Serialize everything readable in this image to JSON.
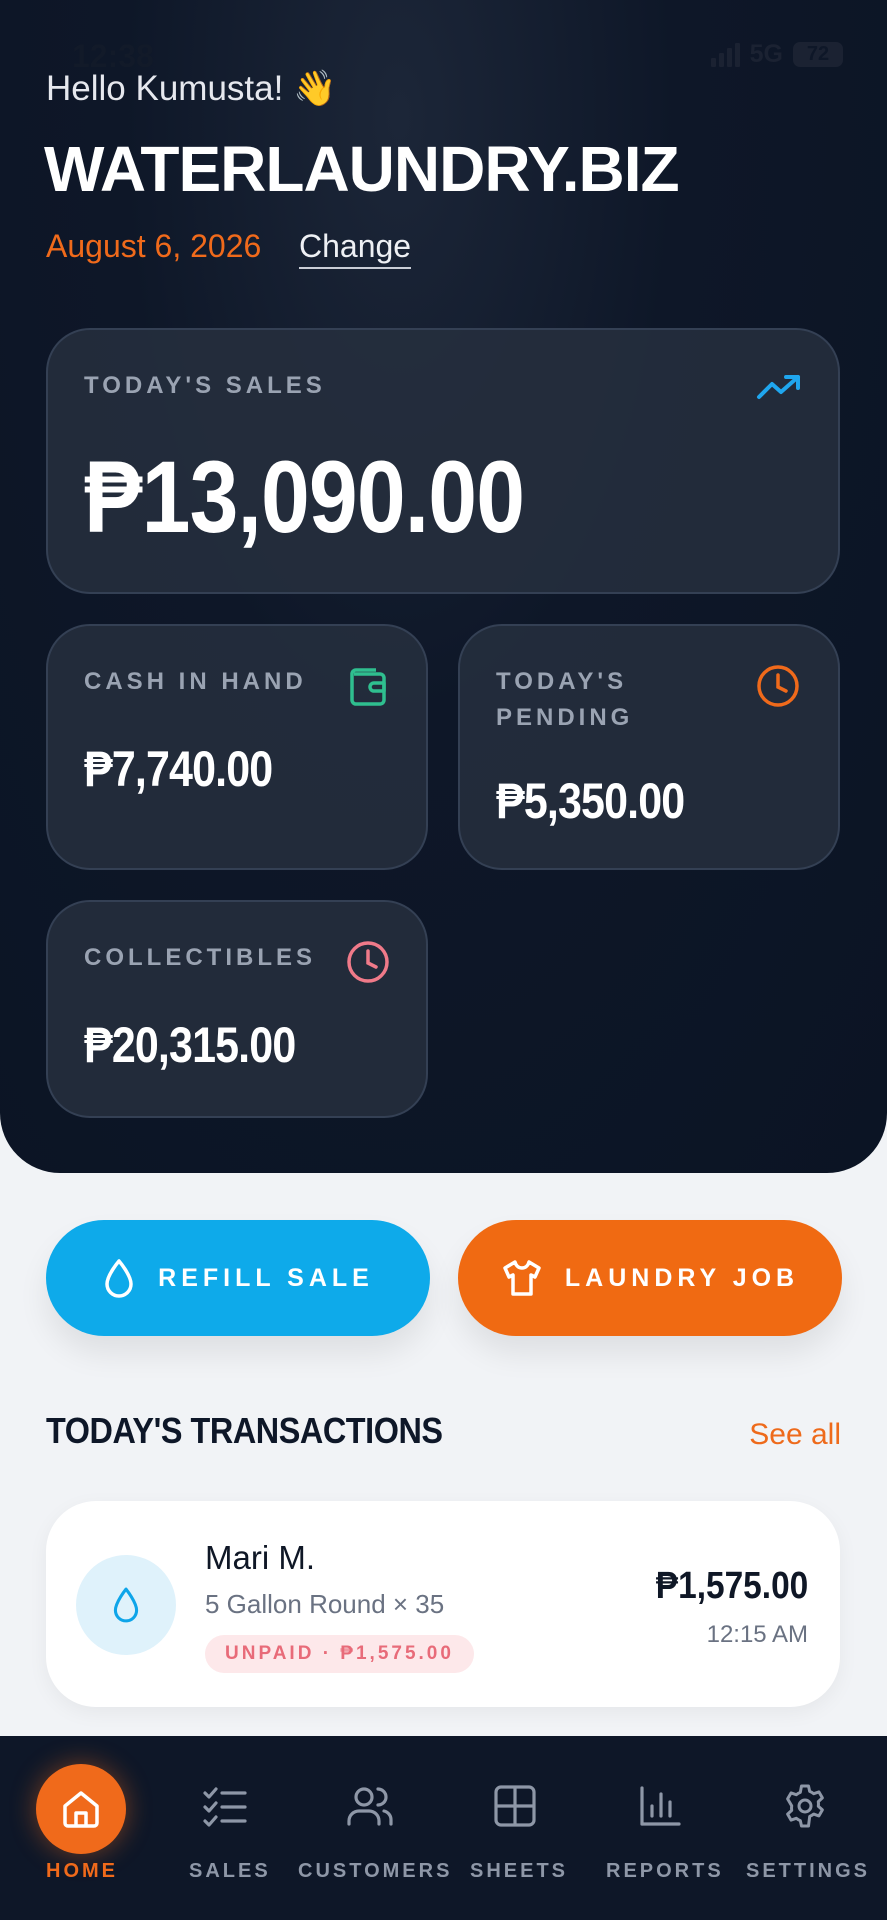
{
  "status_bar": {
    "time": "12:38",
    "network": "5G",
    "battery": "72"
  },
  "header": {
    "greeting": "Hello Kumusta! 👋",
    "brand": "WATERLAUNDRY.BIZ",
    "date": "August 6, 2026",
    "change_label": "Change"
  },
  "stats": {
    "today_sales": {
      "label": "TODAY'S SALES",
      "value": "₱13,090.00",
      "icon": "trending-up-icon"
    },
    "cash_in_hand": {
      "label": "CASH IN HAND",
      "value": "₱7,740.00",
      "icon": "wallet-icon"
    },
    "today_pending": {
      "label_line1": "TODAY'S",
      "label_line2": "PENDING",
      "value": "₱5,350.00",
      "icon": "clock-icon"
    },
    "collectibles": {
      "label": "COLLECTIBLES",
      "value": "₱20,315.00",
      "icon": "clock-icon"
    }
  },
  "actions": {
    "refill_label": "REFILL SALE",
    "laundry_label": "LAUNDRY JOB"
  },
  "transactions": {
    "title": "TODAY'S TRANSACTIONS",
    "see_all": "See all",
    "items": [
      {
        "name": "Mari M.",
        "description": "5 Gallon Round × 35",
        "badge": "UNPAID · ₱1,575.00",
        "amount": "₱1,575.00",
        "time": "12:15 AM",
        "icon": "water-drop-icon"
      }
    ]
  },
  "nav": {
    "items": [
      {
        "label": "HOME",
        "icon": "home-icon"
      },
      {
        "label": "SALES",
        "icon": "checklist-icon"
      },
      {
        "label": "CUSTOMERS",
        "icon": "users-icon"
      },
      {
        "label": "SHEETS",
        "icon": "grid-icon"
      },
      {
        "label": "REPORTS",
        "icon": "bar-chart-icon"
      },
      {
        "label": "SETTINGS",
        "icon": "gear-icon"
      }
    ]
  },
  "colors": {
    "accent_orange": "#f06a1b",
    "accent_blue": "#0ea5e9",
    "navy": "#0e1728",
    "green_icon": "#2fbf8f",
    "pink_icon": "#f07a89"
  }
}
